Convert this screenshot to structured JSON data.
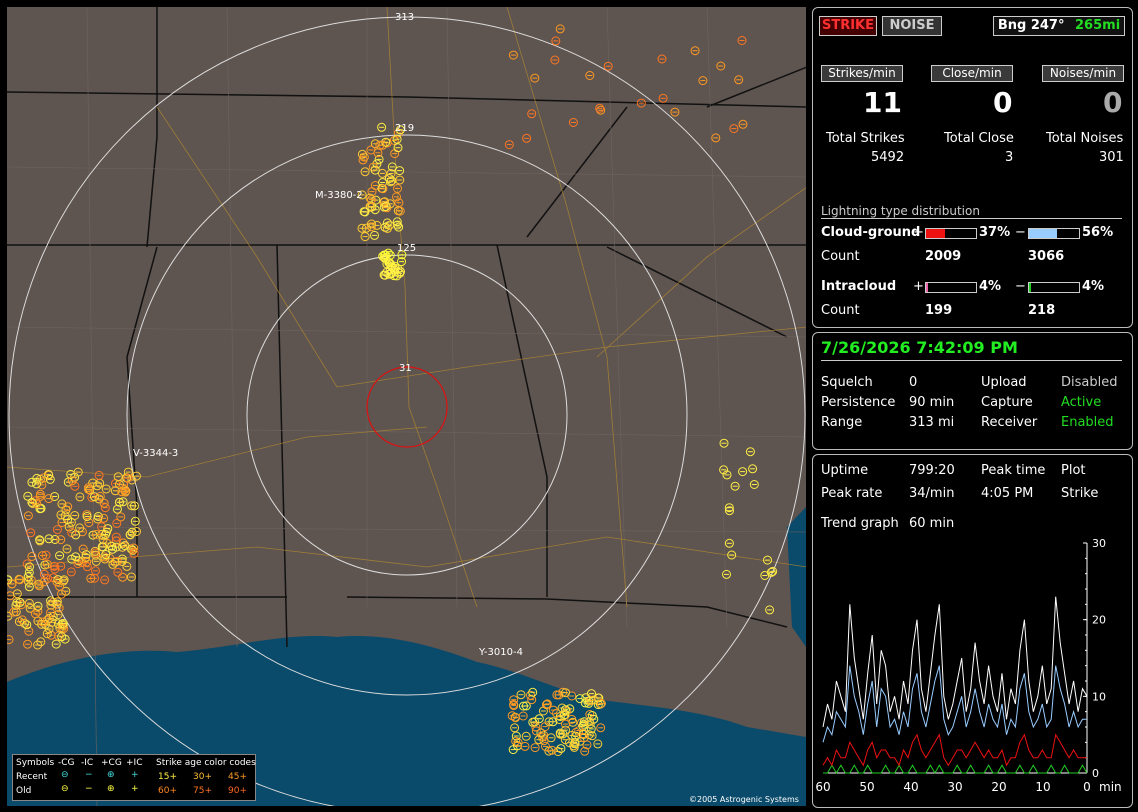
{
  "header": {
    "strike_label": "STRIKE",
    "noise_label": "NOISE",
    "bearing": "Bng 247°",
    "range": "265mi"
  },
  "rates": {
    "strikes_label": "Strikes/min",
    "strikes_value": "11",
    "close_label": "Close/min",
    "close_value": "0",
    "noises_label": "Noises/min",
    "noises_value": "0"
  },
  "totals": {
    "strikes_label": "Total Strikes",
    "strikes_value": "5492",
    "close_label": "Total Close",
    "close_value": "3",
    "noises_label": "Total Noises",
    "noises_value": "301"
  },
  "distribution": {
    "title": "Lightning type distribution",
    "cg_label": "Cloud-ground",
    "ic_label": "Intracloud",
    "count_label": "Count",
    "plus_sign": "+",
    "minus_sign": "−",
    "cg_plus_pct": "37%",
    "cg_plus_fill": 0.37,
    "cg_plus_count": "2009",
    "cg_minus_pct": "56%",
    "cg_minus_fill": 0.56,
    "cg_minus_count": "3066",
    "ic_plus_pct": "4%",
    "ic_plus_fill": 0.04,
    "ic_plus_count": "199",
    "ic_minus_pct": "4%",
    "ic_minus_fill": 0.04,
    "ic_minus_count": "218",
    "colors": {
      "cg_plus": "#ee1111",
      "cg_minus": "#99ccff",
      "ic_plus": "#ee66aa",
      "ic_minus": "#22cc22"
    }
  },
  "status": {
    "datetime": "7/26/2026 7:42:09 PM",
    "squelch_label": "Squelch",
    "squelch_value": "0",
    "persistence_label": "Persistence",
    "persistence_value": "90 min",
    "range_label": "Range",
    "range_value": "313 mi",
    "upload_label": "Upload",
    "upload_value": "Disabled",
    "capture_label": "Capture",
    "capture_value": "Active",
    "receiver_label": "Receiver",
    "receiver_value": "Enabled"
  },
  "stats": {
    "uptime_label": "Uptime",
    "uptime_value": "799:20",
    "peaktime_label": "Peak time",
    "peaktime_value": "4:05 PM",
    "plot_label": "Plot",
    "plot_value": "Strike",
    "peakrate_label": "Peak rate",
    "peakrate_value": "34/min",
    "trend_label": "Trend graph",
    "trend_value": "60 min"
  },
  "trend_graph": {
    "y_ticks": [
      "30",
      "20",
      "10",
      "0"
    ],
    "x_ticks": [
      "60",
      "50",
      "40",
      "30",
      "20",
      "10",
      "0"
    ],
    "x_unit": "min",
    "y_max": 30,
    "total_series": [
      6,
      9,
      7,
      12,
      10,
      8,
      22,
      15,
      11,
      7,
      13,
      18,
      9,
      16,
      14,
      8,
      10,
      7,
      12,
      9,
      16,
      20,
      11,
      8,
      13,
      18,
      22,
      10,
      7,
      9,
      12,
      15,
      8,
      11,
      17,
      12,
      9,
      14,
      10,
      8,
      13,
      7,
      11,
      9,
      16,
      20,
      12,
      8,
      10,
      14,
      9,
      11,
      23,
      17,
      13,
      9,
      12,
      8,
      11,
      10
    ],
    "minus_series": [
      4,
      6,
      5,
      8,
      7,
      6,
      14,
      10,
      8,
      5,
      9,
      12,
      6,
      11,
      10,
      6,
      7,
      5,
      8,
      6,
      11,
      13,
      8,
      6,
      9,
      12,
      14,
      7,
      5,
      6,
      8,
      10,
      6,
      8,
      11,
      8,
      6,
      9,
      7,
      6,
      9,
      5,
      7,
      6,
      11,
      13,
      8,
      6,
      7,
      9,
      6,
      7,
      14,
      11,
      9,
      6,
      8,
      6,
      7,
      7
    ],
    "plus_series": [
      1,
      2,
      1,
      3,
      2,
      2,
      4,
      3,
      2,
      1,
      3,
      4,
      2,
      3,
      3,
      2,
      2,
      1,
      3,
      2,
      4,
      5,
      3,
      2,
      3,
      4,
      5,
      2,
      1,
      2,
      3,
      3,
      2,
      3,
      4,
      3,
      2,
      3,
      2,
      2,
      3,
      1,
      2,
      2,
      4,
      5,
      3,
      2,
      2,
      3,
      2,
      2,
      5,
      4,
      3,
      2,
      3,
      2,
      2,
      2
    ],
    "ic_series": [
      0,
      0,
      1,
      0,
      1,
      0,
      0,
      1,
      0,
      0,
      1,
      0,
      0,
      0,
      1,
      0,
      0,
      1,
      0,
      0,
      1,
      0,
      0,
      0,
      1,
      0,
      1,
      0,
      0,
      0,
      1,
      0,
      0,
      1,
      0,
      0,
      0,
      1,
      0,
      0,
      1,
      0,
      0,
      0,
      1,
      0,
      0,
      1,
      0,
      0,
      0,
      1,
      0,
      0,
      1,
      0,
      0,
      0,
      1,
      0
    ],
    "colors": {
      "total": "#ffffff",
      "minus": "#99ccff",
      "plus": "#ee1111",
      "ic": "#22cc22"
    }
  },
  "map": {
    "ring_labels": [
      "313",
      "219",
      "125",
      "31"
    ],
    "storm_labels": [
      "M-3380-2",
      "V-3344-3",
      "Y-3010-4"
    ],
    "copyright": "©2005 Astrogenic Systems"
  },
  "legend": {
    "symbols_label": "Symbols",
    "minus_cg": "-CG",
    "minus_ic": "-IC",
    "plus_cg": "+CG",
    "plus_ic": "+IC",
    "age_label": "Strike age color codes",
    "recent_label": "Recent",
    "old_label": "Old",
    "age_15": "15+",
    "age_30": "30+",
    "age_45": "45+",
    "age_60": "60+",
    "age_75": "75+",
    "age_90": "90+"
  }
}
